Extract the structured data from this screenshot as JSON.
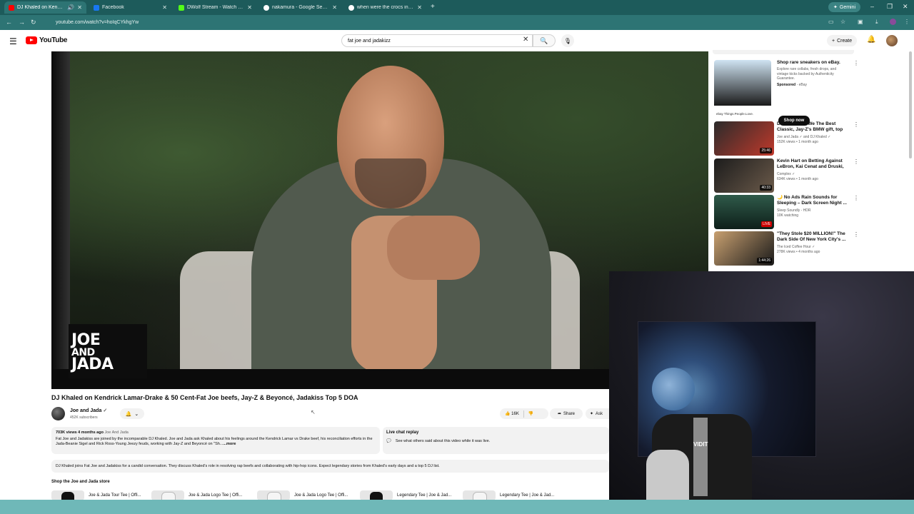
{
  "browser": {
    "tabs": [
      {
        "title": "DJ Khaled on Kendrick Lamar",
        "favicon_color": "#ff0000",
        "active": true
      },
      {
        "title": "Facebook",
        "favicon_color": "#1877f2",
        "active": false
      },
      {
        "title": "DWolf Stream - Watch Live on",
        "favicon_color": "#53fc18",
        "active": false
      },
      {
        "title": "nakamura - Google Search",
        "favicon_color": "#ffffff",
        "active": false
      },
      {
        "title": "when were the crocs invented",
        "favicon_color": "#ffffff",
        "active": false
      }
    ],
    "gemini_label": "Gemini",
    "url": "youtube.com/watch?v=hoIqCYkhgYw"
  },
  "youtube": {
    "logo_text": "YouTube",
    "search_value": "fat joe and jadakizz",
    "create_label": "Create"
  },
  "video": {
    "overlay_logo": {
      "line1": "JOE",
      "line2": "AND",
      "line3": "JADA"
    },
    "title": "DJ Khaled on Kendrick Lamar-Drake & 50 Cent-Fat Joe beefs, Jay-Z & Beyoncé, Jadakiss Top 5 DOA",
    "channel": "Joe and Jada",
    "subscribers": "452K subscribers",
    "likes": "16K",
    "share_label": "Share",
    "ask_label": "Ask"
  },
  "description": {
    "meta": "703K views  4 months ago",
    "meta_link": "Joe And Jada",
    "text": "Fat Joe and Jadakiss are joined by the incomparable DJ Khaled. Joe and Jada ask Khaled about his feelings around the Kendrick Lamar vs Drake beef, his reconciliation efforts in the Jada-Beanie Sigel and Rick Ross-Young Jeezy feuds, working with Jay-Z and Beyoncé on \"Sh...",
    "more": "...more"
  },
  "live_chat": {
    "title": "Live chat replay",
    "text": "See what others said about this video while it was live."
  },
  "summary": "DJ Khaled joins Fat Joe and Jadakiss for a candid conversation. They discuss Khaled's role in resolving rap beefs and collaborating with hip-hop icons. Expect legendary stories from Khaled's early days and a top 5 DJ list.",
  "store": {
    "title": "Shop the Joe and Jada store",
    "products": [
      {
        "name": "Joe & Jada Tour Tee | Offi..."
      },
      {
        "name": "Joe & Jada Logo Tee | Offi..."
      },
      {
        "name": "Joe & Jada Logo Tee | Offi..."
      },
      {
        "name": "Legendary Tee | Joe & Jad..."
      },
      {
        "name": "Legendary Tee | Joe & Jad..."
      }
    ]
  },
  "sidebar": {
    "ad": {
      "title": "Shop rare sneakers on eBay.",
      "desc": "Explore rare collabs, fresh drops, and vintage kicks backed by Authenticity Guarantee.",
      "sponsored": "Sponsored",
      "advertiser": "eBay",
      "cta": "Shop now",
      "thumb_caption": "ebay   Things.People.Love."
    },
    "recs": [
      {
        "title": "DJ Khaled on We The Best Classic, Jay-Z's BMW gift, top ...",
        "channel": "Joe and Jada ✓ and DJ Khaled ✓",
        "views": "152K views • 1 month ago",
        "duration": "25:46",
        "thumb_a": "#2b2b2b",
        "thumb_b": "#c0392b"
      },
      {
        "title": "Kevin Hart on Betting Against LeBron, Kai Cenat and Druski, ...",
        "channel": "Complex ✓",
        "views": "634K views • 1 month ago",
        "duration": "40:33",
        "thumb_a": "#1c1c1c",
        "thumb_b": "#6b5a4a"
      },
      {
        "title": "🌙 No Ads Rain Sounds for Sleeping – Dark Screen Night ...",
        "channel": "Sleep Soundly - HDR",
        "views": "10K watching",
        "duration": "LIVE",
        "thumb_a": "#2f5a4a",
        "thumb_b": "#0e1f1a"
      },
      {
        "title": "\"They Stole $20 MILLION!\" The Dark Side Of New York City's ...",
        "channel": "The Iced Coffee Hour ✓",
        "views": "278K views • 4 months ago",
        "duration": "1:44:26",
        "thumb_a": "#c8a070",
        "thumb_b": "#1a1a1a"
      }
    ]
  },
  "webcam": {
    "chair_label": "VIDIT"
  },
  "colors": {
    "chrome_bg": "#1d5b5b",
    "urlbar_bg": "#2d7474",
    "youtube_red": "#ff0000"
  }
}
